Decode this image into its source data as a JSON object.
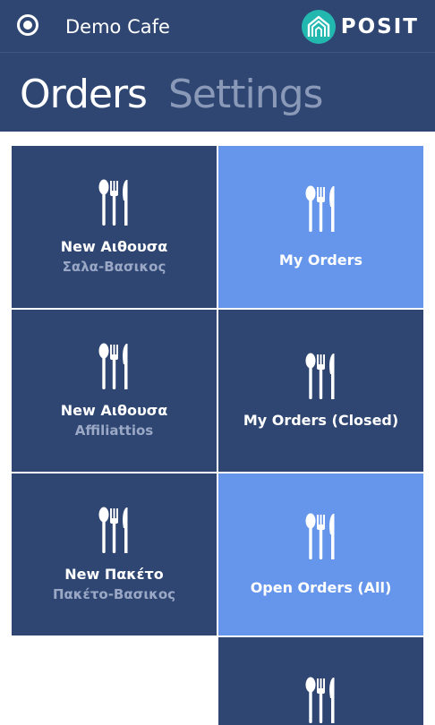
{
  "header": {
    "cafe_name": "Demo Cafe",
    "logo_text": "POSIT"
  },
  "pivot": {
    "tabs": [
      {
        "label": "Orders",
        "active": true
      },
      {
        "label": "Settings",
        "active": false
      }
    ]
  },
  "tiles": [
    {
      "title": "New Αιθουσα",
      "subtitle": "Σαλα-Βασικος",
      "icon": "cutlery-icon"
    },
    {
      "title": "My Orders",
      "subtitle": "",
      "icon": "cutlery-icon"
    },
    {
      "title": "New Αιθουσα",
      "subtitle": "Affiliattios",
      "icon": "cutlery-icon"
    },
    {
      "title": "My Orders (Closed)",
      "subtitle": "",
      "icon": "cutlery-icon"
    },
    {
      "title": "New Πακέτο",
      "subtitle": "Πακέτο-Βασικος",
      "icon": "cutlery-icon"
    },
    {
      "title": "Open Orders (All)",
      "subtitle": "",
      "icon": "cutlery-icon"
    },
    {
      "title": "",
      "subtitle": "",
      "icon": "cutlery-icon"
    }
  ],
  "colors": {
    "header_bg": "#2f4672",
    "tile_dark": "#2f4672",
    "tile_light": "#6596ec",
    "logo_teal": "#22b8b0"
  }
}
